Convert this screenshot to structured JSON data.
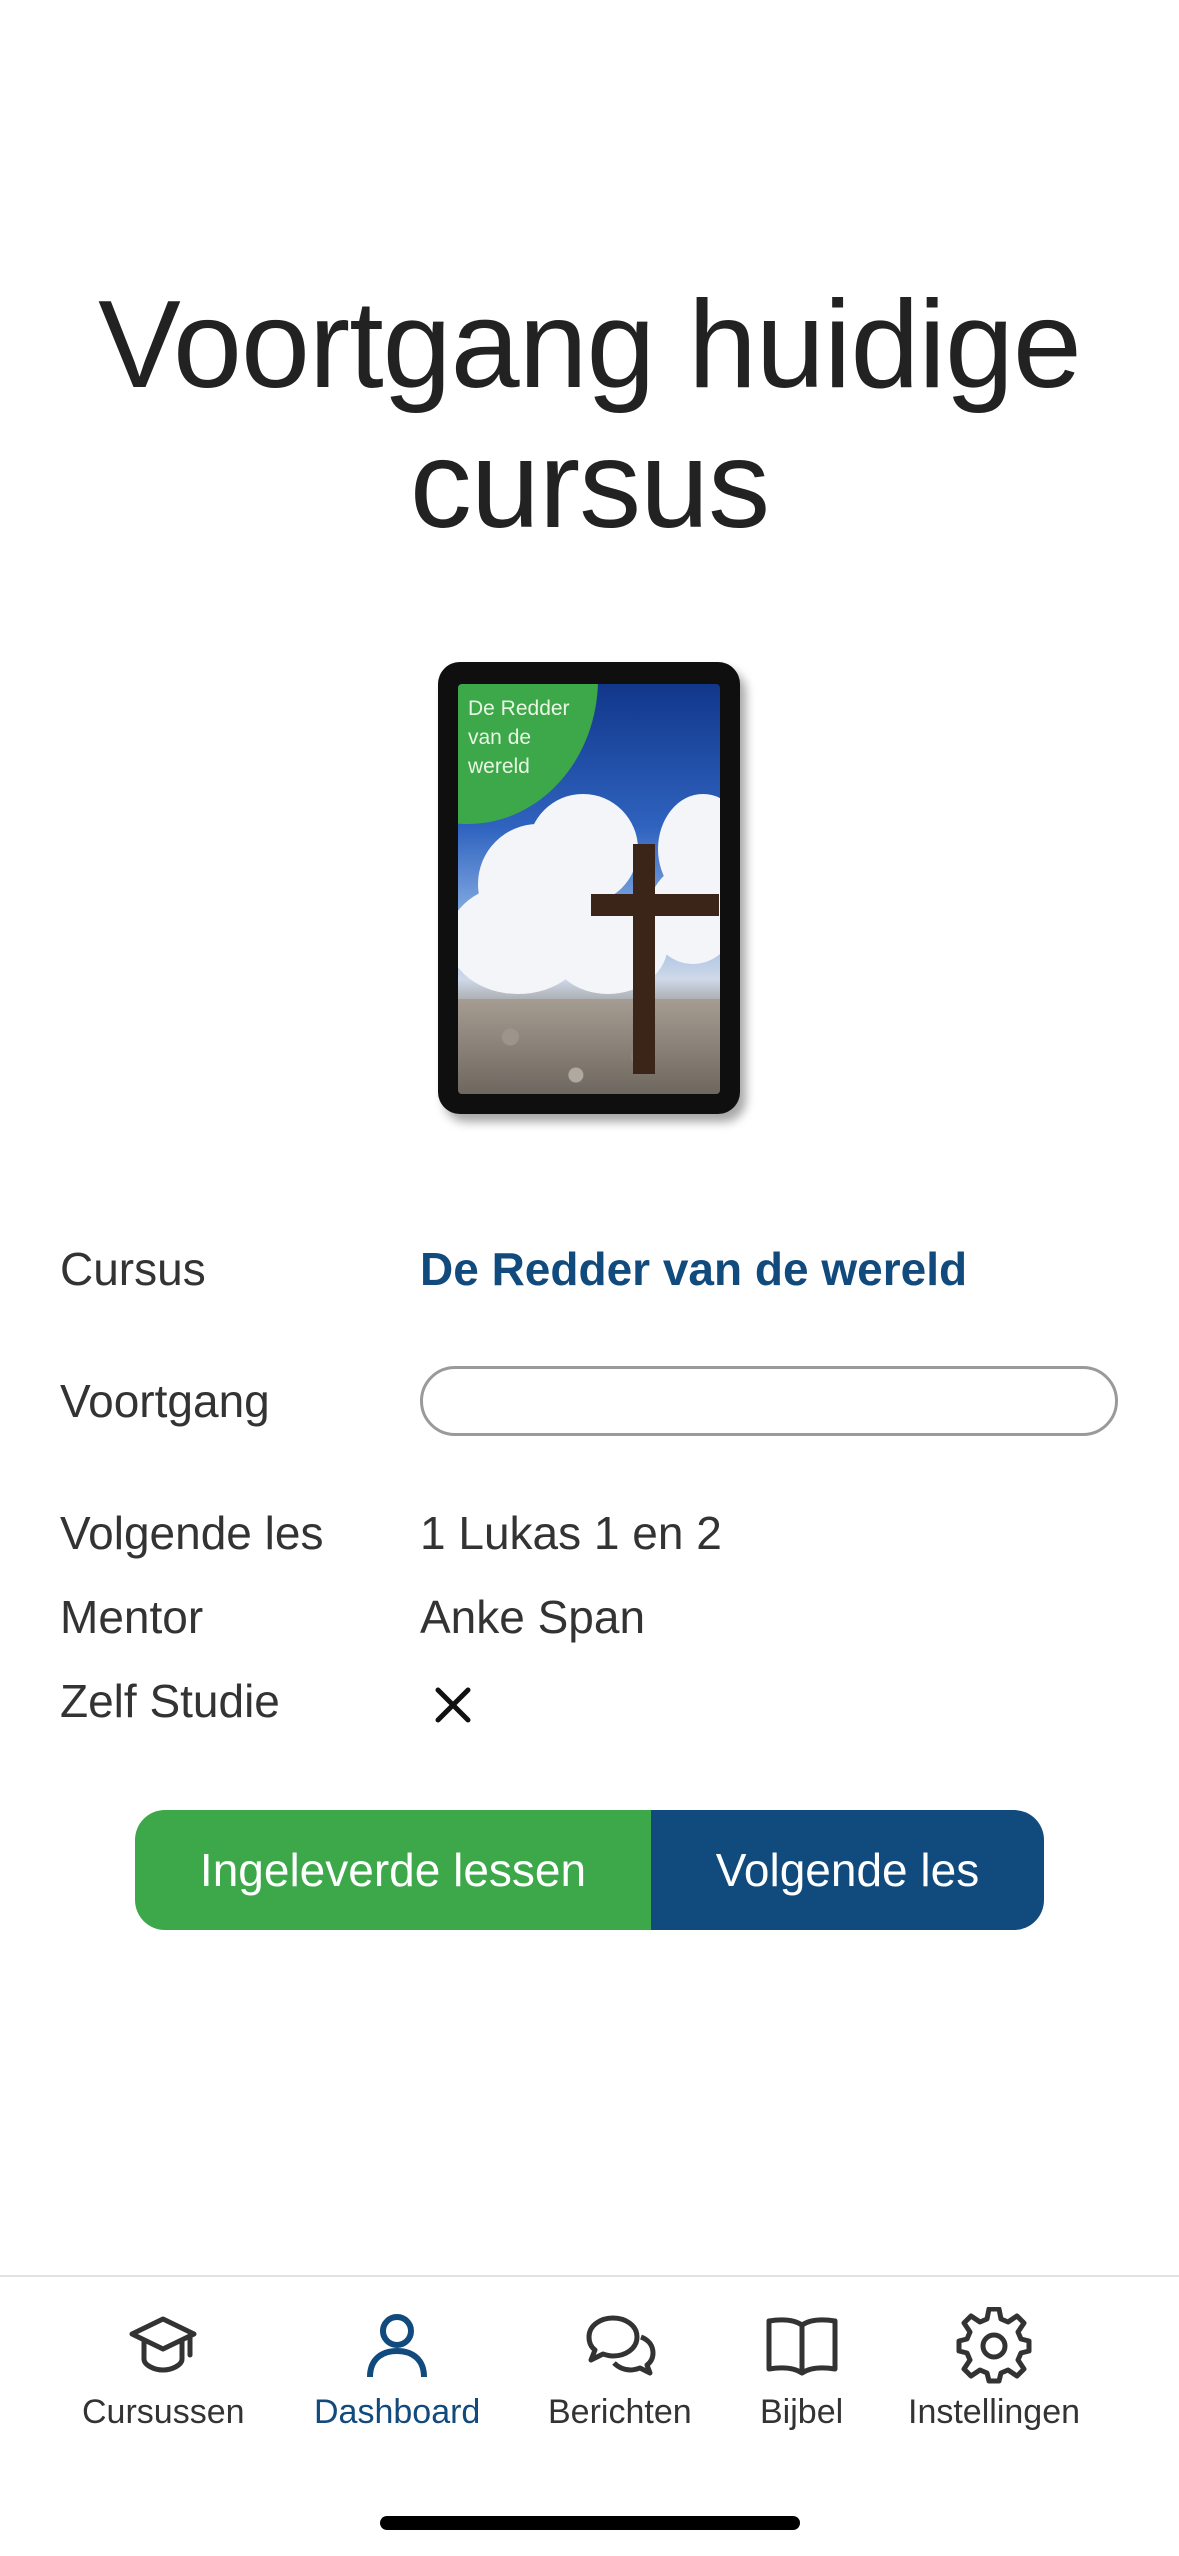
{
  "page_title": "Voortgang huidige cursus",
  "cover": {
    "title_text": "De Redder van de wereld"
  },
  "info": {
    "course_label": "Cursus",
    "course_value": "De Redder van de wereld",
    "progress_label": "Voortgang",
    "progress_fraction": 0,
    "next_lesson_label": "Volgende les",
    "next_lesson_value": "1 Lukas 1 en 2",
    "mentor_label": "Mentor",
    "mentor_value": "Anke Span",
    "self_study_label": "Zelf Studie",
    "self_study_icon": "x-icon"
  },
  "buttons": {
    "submitted_lessons": "Ingeleverde lessen",
    "next_lesson": "Volgende les"
  },
  "tabs": [
    {
      "label": "Cursussen",
      "icon": "graduation-cap-icon",
      "active": false
    },
    {
      "label": "Dashboard",
      "icon": "user-icon",
      "active": true
    },
    {
      "label": "Berichten",
      "icon": "chat-bubbles-icon",
      "active": false
    },
    {
      "label": "Bijbel",
      "icon": "book-icon",
      "active": false
    },
    {
      "label": "Instellingen",
      "icon": "gear-icon",
      "active": false
    }
  ],
  "colors": {
    "accent_blue": "#114a7d",
    "accent_green": "#3ca84a"
  }
}
